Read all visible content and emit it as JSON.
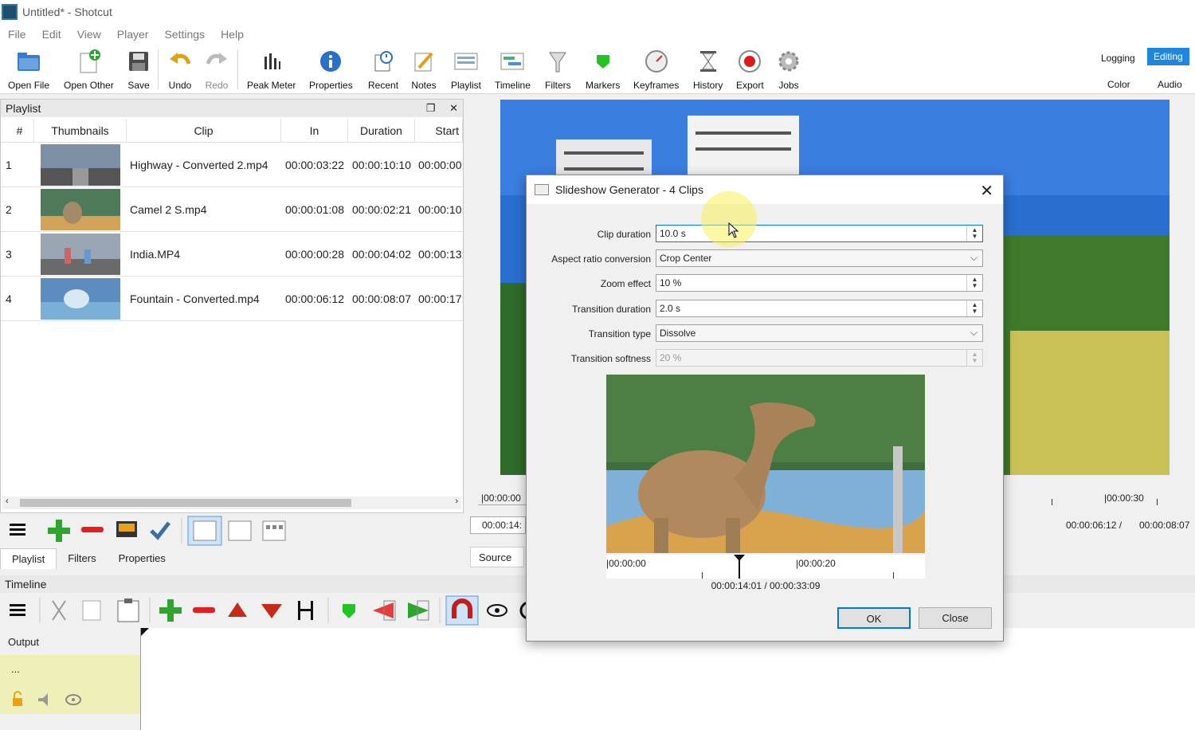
{
  "window": {
    "title": "Untitled* - Shotcut"
  },
  "menu": [
    "File",
    "Edit",
    "View",
    "Player",
    "Settings",
    "Help"
  ],
  "toolbar": {
    "open_file": "Open File",
    "open_other": "Open Other",
    "save": "Save",
    "undo": "Undo",
    "redo": "Redo",
    "peak_meter": "Peak Meter",
    "properties": "Properties",
    "recent": "Recent",
    "notes": "Notes",
    "playlist": "Playlist",
    "timeline": "Timeline",
    "filters": "Filters",
    "markers": "Markers",
    "keyframes": "Keyframes",
    "history": "History",
    "export": "Export",
    "jobs": "Jobs"
  },
  "layouts": {
    "logging": "Logging",
    "editing": "Editing",
    "color": "Color",
    "audio": "Audio"
  },
  "playlist": {
    "title": "Playlist",
    "columns": [
      "#",
      "Thumbnails",
      "Clip",
      "In",
      "Duration",
      "Start"
    ],
    "rows": [
      {
        "num": "1",
        "clip": "Highway - Converted 2.mp4",
        "in": "00:00:03:22",
        "duration": "00:00:10:10",
        "start": "00:00:00:"
      },
      {
        "num": "2",
        "clip": "Camel 2 S.mp4",
        "in": "00:00:01:08",
        "duration": "00:00:02:21",
        "start": "00:00:10:"
      },
      {
        "num": "3",
        "clip": "India.MP4",
        "in": "00:00:00:28",
        "duration": "00:00:04:02",
        "start": "00:00:13:"
      },
      {
        "num": "4",
        "clip": "Fountain - Converted.mp4",
        "in": "00:00:06:12",
        "duration": "00:00:08:07",
        "start": "00:00:17:"
      }
    ],
    "tabs": [
      "Playlist",
      "Filters",
      "Properties"
    ]
  },
  "player": {
    "ruler_left": "|00:00:00",
    "ruler_right": "|00:00:30",
    "timecode_left": "00:00:14:",
    "source_tab": "Source",
    "position": "00:00:06:12 /",
    "duration": "00:00:08:07"
  },
  "timeline": {
    "title": "Timeline",
    "track_name": "Output",
    "track_menu": "..."
  },
  "dialog": {
    "title": "Slideshow Generator - 4 Clips",
    "fields": {
      "clip_duration": {
        "label": "Clip duration",
        "value": "10.0 s"
      },
      "aspect": {
        "label": "Aspect ratio conversion",
        "value": "Crop Center"
      },
      "zoom": {
        "label": "Zoom effect",
        "value": "10 %"
      },
      "transition_duration": {
        "label": "Transition duration",
        "value": "2.0 s"
      },
      "transition_type": {
        "label": "Transition type",
        "value": "Dissolve"
      },
      "softness": {
        "label": "Transition softness",
        "value": "20 %"
      }
    },
    "ruler_start": "|00:00:00",
    "ruler_mid": "|00:00:20",
    "timecode": "00:00:14:01 / 00:00:33:09",
    "ok": "OK",
    "close": "Close"
  }
}
